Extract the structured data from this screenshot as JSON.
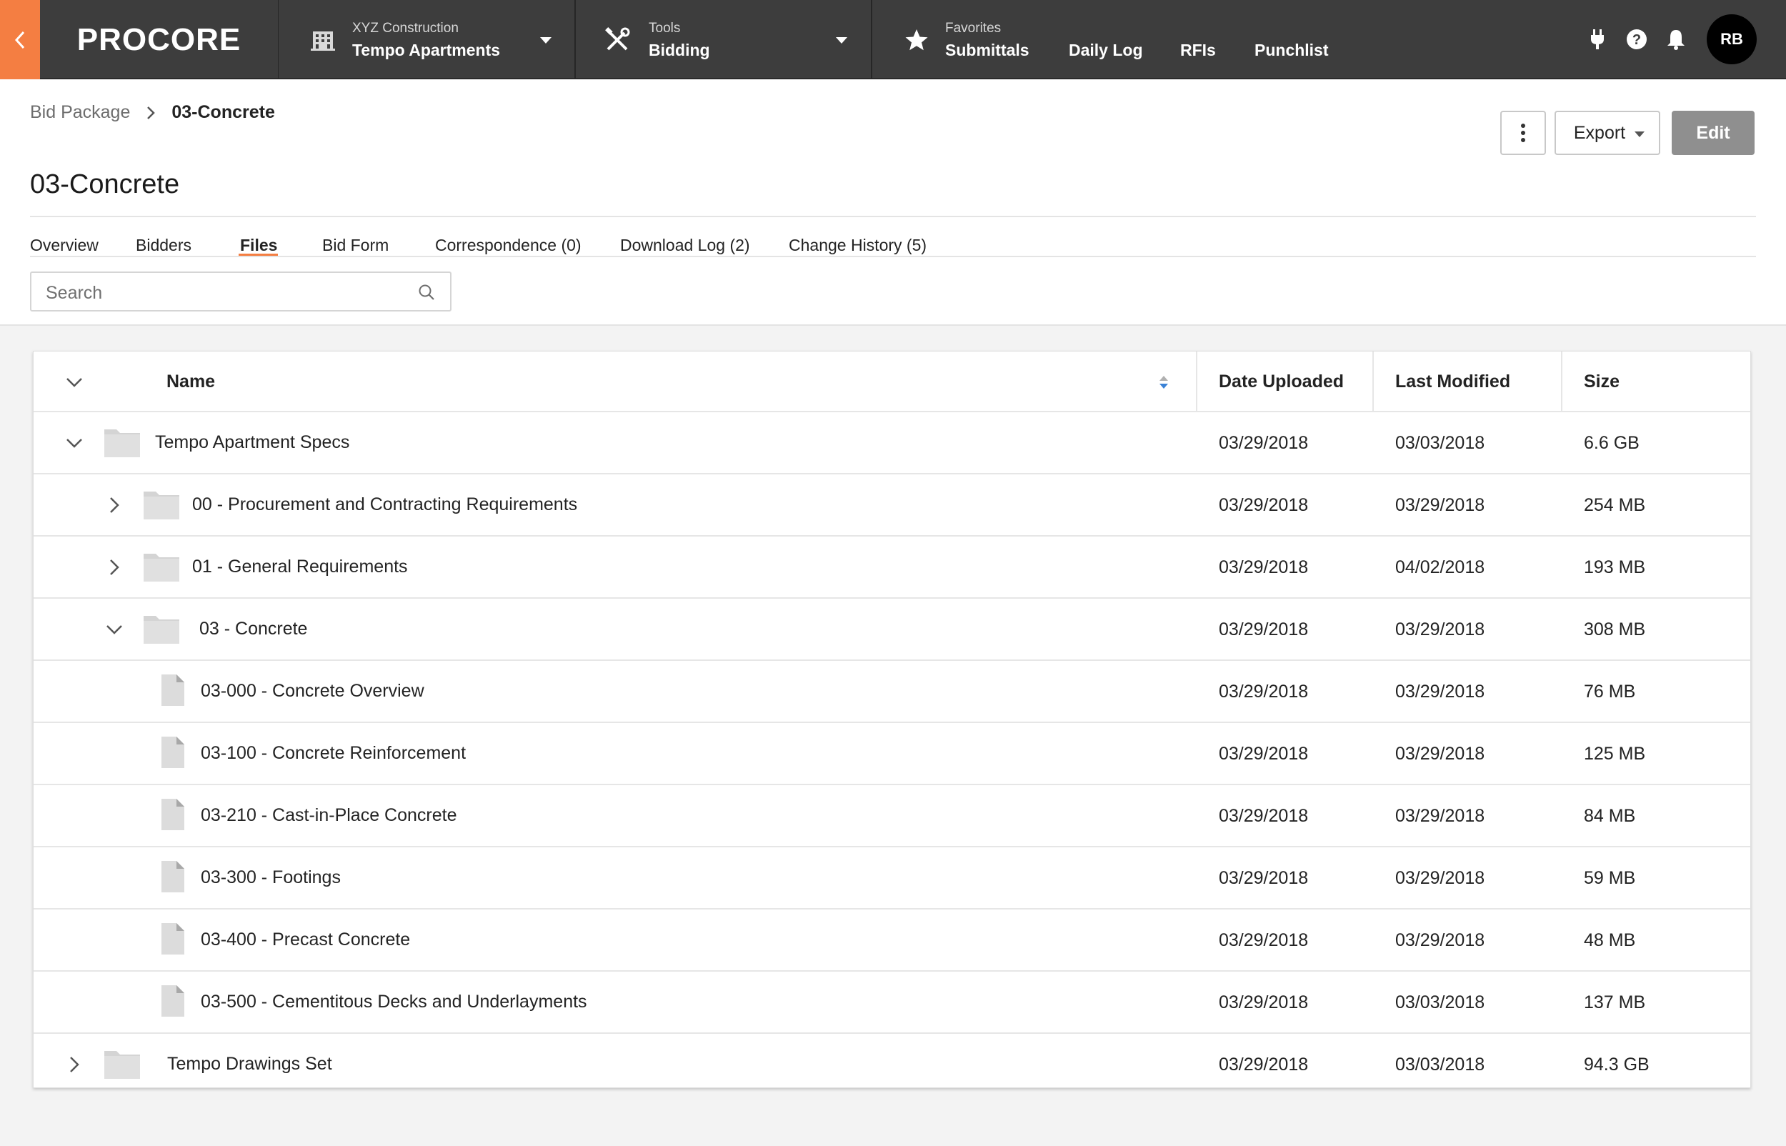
{
  "nav": {
    "logo": "PROCORE",
    "project": {
      "company": "XYZ Construction",
      "name": "Tempo Apartments"
    },
    "tools": {
      "label": "Tools",
      "current": "Bidding"
    },
    "favorites": {
      "label": "Favorites",
      "items": [
        "Submittals",
        "Daily Log",
        "RFIs",
        "Punchlist"
      ]
    },
    "user_initials": "RB"
  },
  "breadcrumb": {
    "parent": "Bid Package",
    "current": "03-Concrete"
  },
  "page_title": "03-Concrete",
  "actions": {
    "export": "Export",
    "edit": "Edit"
  },
  "tabs": [
    "Overview",
    "Bidders",
    "Files",
    "Bid Form",
    "Correspondence (0)",
    "Download Log (2)",
    "Change History (5)"
  ],
  "active_tab": "Files",
  "search": {
    "placeholder": "Search"
  },
  "table": {
    "columns": [
      "Name",
      "Date Uploaded",
      "Last Modified",
      "Size"
    ],
    "rows": [
      {
        "name": "Tempo Apartment Specs",
        "uploaded": "03/29/2018",
        "modified": "03/03/2018",
        "size": "6.6 GB",
        "type": "folder",
        "state": "expanded"
      },
      {
        "name": "00 - Procurement and Contracting Requirements",
        "uploaded": "03/29/2018",
        "modified": "03/29/2018",
        "size": "254 MB",
        "type": "folder",
        "state": "collapsed"
      },
      {
        "name": "01 - General Requirements",
        "uploaded": "03/29/2018",
        "modified": "04/02/2018",
        "size": "193 MB",
        "type": "folder",
        "state": "collapsed"
      },
      {
        "name": "03 - Concrete",
        "uploaded": "03/29/2018",
        "modified": "03/29/2018",
        "size": "308 MB",
        "type": "folder",
        "state": "expanded"
      },
      {
        "name": "03-000 - Concrete Overview",
        "uploaded": "03/29/2018",
        "modified": "03/29/2018",
        "size": "76 MB",
        "type": "file"
      },
      {
        "name": "03-100 - Concrete Reinforcement",
        "uploaded": "03/29/2018",
        "modified": "03/29/2018",
        "size": "125 MB",
        "type": "file"
      },
      {
        "name": "03-210 - Cast-in-Place Concrete",
        "uploaded": "03/29/2018",
        "modified": "03/29/2018",
        "size": "84 MB",
        "type": "file"
      },
      {
        "name": "03-300 - Footings",
        "uploaded": "03/29/2018",
        "modified": "03/29/2018",
        "size": "59 MB",
        "type": "file"
      },
      {
        "name": "03-400 - Precast Concrete",
        "uploaded": "03/29/2018",
        "modified": "03/29/2018",
        "size": "48 MB",
        "type": "file"
      },
      {
        "name": "03-500 - Cementitous Decks and Underlayments",
        "uploaded": "03/29/2018",
        "modified": "03/03/2018",
        "size": "137 MB",
        "type": "file"
      },
      {
        "name": "Tempo Drawings Set",
        "uploaded": "03/29/2018",
        "modified": "03/03/2018",
        "size": "94.3 GB",
        "type": "folder",
        "state": "collapsed"
      }
    ]
  },
  "icons": {
    "back": "chevron-left-icon",
    "project": "building-icon",
    "tools": "tools-icon",
    "favorites": "star-icon",
    "utilities": [
      "plug-icon",
      "help-icon",
      "bell-icon"
    ],
    "folder": "folder-icon",
    "file": "file-icon"
  },
  "colors": {
    "accent": "#f47e42",
    "nav_bg": "#3d3d3d",
    "edit_button": "#8f8f8f",
    "sort_indicator": "#3b82d6"
  }
}
